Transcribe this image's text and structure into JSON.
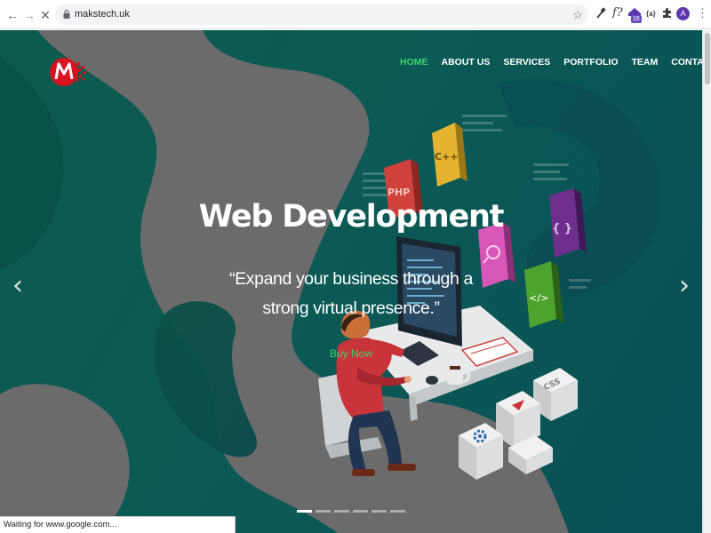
{
  "browser": {
    "url": "makstech.uk",
    "extension_badge": "16",
    "extension_a_label": "{a}",
    "profile_initial": "A",
    "status_text": "Waiting for www.google.com..."
  },
  "site": {
    "nav": [
      {
        "label": "HOME",
        "active": true
      },
      {
        "label": "ABOUT US",
        "active": false
      },
      {
        "label": "SERVICES",
        "active": false
      },
      {
        "label": "PORTFOLIO",
        "active": false
      },
      {
        "label": "TEAM",
        "active": false
      },
      {
        "label": "CONTACT",
        "active": false
      }
    ],
    "hero": {
      "title": "Web Development",
      "quote": "“Expand your business through a strong virtual presence.”",
      "cta_label": "Buy Now"
    },
    "carousel": {
      "prev_glyph": "‹",
      "next_glyph": "›",
      "slide_count": 6,
      "active_slide": 1
    },
    "illustration_labels": {
      "php": "PHP",
      "cpp": "C++",
      "braces": "{ }",
      "code": "</>",
      "css": "CSS"
    }
  },
  "colors": {
    "accent_green": "#3ed36a",
    "hero_bg": "#0b5a52",
    "blob_gray": "#6b6b6b",
    "logo_red": "#d7141f"
  }
}
